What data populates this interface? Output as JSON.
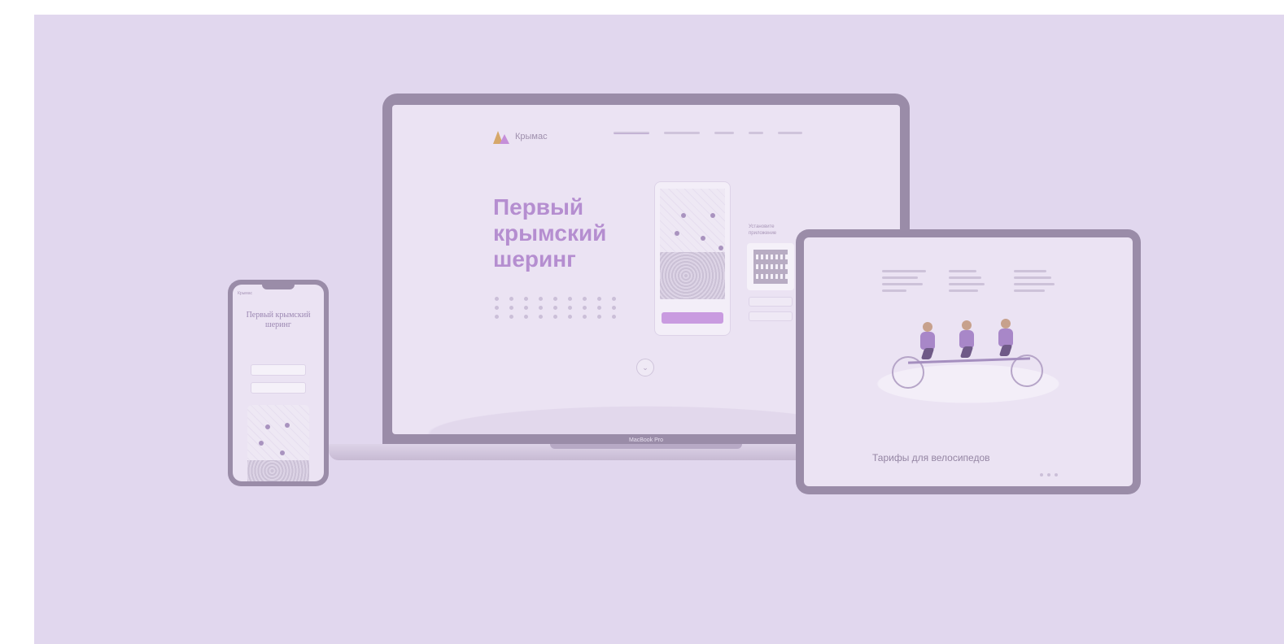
{
  "laptop": {
    "brand_logo_text": "Крымас",
    "hero_title": "Первый крымский шеринг",
    "qr_caption": "Установите приложение",
    "chin_label": "MacBook Pro"
  },
  "tablet": {
    "heading": "Тарифы для велосипедов"
  },
  "phone": {
    "brand_logo_text": "Крымас",
    "hero_title": "Первый крымский шеринг"
  },
  "colors": {
    "background": "#e1d7ee",
    "accent": "#b58ed0",
    "device_frame": "#9a8ca8"
  }
}
